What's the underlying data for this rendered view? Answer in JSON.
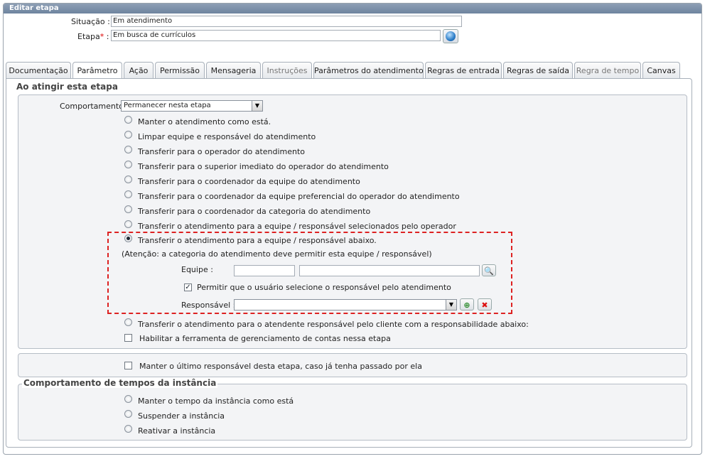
{
  "window": {
    "title": "Editar etapa"
  },
  "header": {
    "situacao_label": "Situação :",
    "situacao_value": "Em atendimento",
    "etapa_label": "Etapa",
    "etapa_required": "*",
    "etapa_colon": " :",
    "etapa_value": "Em busca de currículos"
  },
  "tabs": [
    "Documentação",
    "Parâmetro",
    "Ação",
    "Permissão",
    "Mensageria",
    "Instruções",
    "Parâmetros do atendimento",
    "Regras de entrada",
    "Regras de saída",
    "Regra de tempo",
    "Canvas"
  ],
  "section1": {
    "legend": "Ao atingir esta etapa",
    "comportamento_label": "Comportamento :",
    "comportamento_value": "Permanecer nesta etapa",
    "options": [
      "Manter o atendimento como está.",
      "Limpar equipe e responsável do atendimento",
      "Transferir para o operador do atendimento",
      "Transferir para o superior imediato do operador do atendimento",
      "Transferir para o coordenador da equipe do atendimento",
      "Transferir para o coordenador da equipe preferencial do operador do atendimento",
      "Transferir para o coordenador da categoria do atendimento",
      "Transferir o atendimento para a equipe / responsável selecionados pelo operador",
      "Transferir o atendimento para a equipe / responsável abaixo."
    ],
    "selected_index": 8,
    "attention": "(Atenção: a categoria do atendimento deve permitir esta equipe / responsável)",
    "equipe_label": "Equipe :",
    "equipe_code": "",
    "equipe_name": "",
    "permitir_label": "Permitir que o usuário selecione o responsável pelo atendimento",
    "permitir_checked": true,
    "responsavel_label": "Responsável :",
    "responsavel_value": "",
    "extra_option": "Transferir o atendimento para o atendente responsável pelo cliente com a responsabilidade abaixo:",
    "habilitar_label": "Habilitar a ferramenta de gerenciamento de contas nessa etapa"
  },
  "section2": {
    "manter_label": "Manter o último responsável desta etapa, caso já tenha passado por ela"
  },
  "section3": {
    "legend": "Comportamento de tempos da instância",
    "options": [
      "Manter o tempo da instância como está",
      "Suspender a instância",
      "Reativar a instância"
    ]
  },
  "colors": {
    "titlebar": "#7a8fa8",
    "highlight_border": "#dd2222"
  }
}
